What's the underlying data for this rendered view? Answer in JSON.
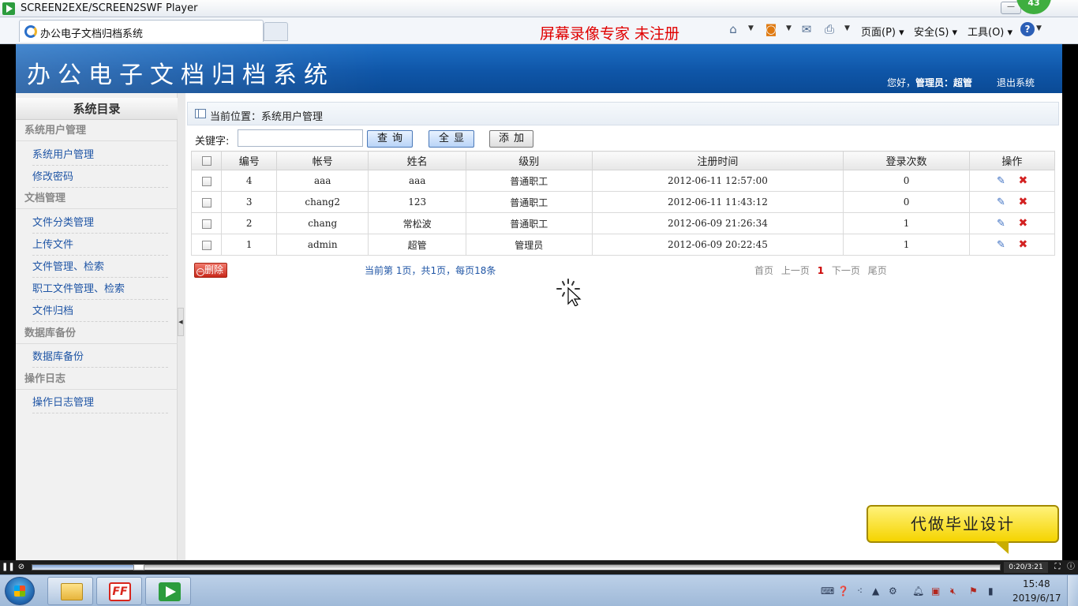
{
  "player": {
    "title": "SCREEN2EXE/SCREEN2SWF Player",
    "min_label": "—",
    "badge": "43",
    "time": "0:20/3:21",
    "progress": 0.11
  },
  "browser": {
    "tab_title": "办公电子文档归档系统",
    "watermark": "屏幕录像专家  未注册",
    "menus": [
      {
        "label": "页面(P)"
      },
      {
        "label": "安全(S)"
      },
      {
        "label": "工具(O)"
      }
    ],
    "help": "?"
  },
  "header": {
    "title": "办公电子文档归档系统",
    "greeting_prefix": "您好，",
    "role": "管理员：",
    "user": "超管",
    "logout": "退出系统"
  },
  "sidebar": {
    "title": "系统目录",
    "groups": [
      {
        "label": "系统用户管理"
      },
      {
        "label": "文档管理"
      },
      {
        "label": "数据库备份"
      },
      {
        "label": "操作日志"
      }
    ],
    "items": [
      {
        "label": "系统用户管理"
      },
      {
        "label": "修改密码"
      },
      {
        "label": "文件分类管理"
      },
      {
        "label": "上传文件"
      },
      {
        "label": "文件管理、检索"
      },
      {
        "label": "职工文件管理、检索"
      },
      {
        "label": "文件归档"
      },
      {
        "label": "数据库备份"
      },
      {
        "label": "操作日志管理"
      }
    ]
  },
  "main": {
    "breadcrumb": "当前位置：系统用户管理",
    "search": {
      "label": "关键字:",
      "value": "",
      "placeholder": ""
    },
    "buttons": {
      "query": "查询",
      "show_all": "全显",
      "add": "添加",
      "delete": "删除"
    },
    "table": {
      "headers": [
        "编号",
        "帐号",
        "姓名",
        "级别",
        "注册时间",
        "登录次数",
        "操作"
      ],
      "rows": [
        {
          "id": "4",
          "account": "aaa",
          "name": "aaa",
          "level": "普通职工",
          "registered": "2012-06-11 12:57:00",
          "logins": "0"
        },
        {
          "id": "3",
          "account": "chang2",
          "name": "123",
          "level": "普通职工",
          "registered": "2012-06-11 11:43:12",
          "logins": "0"
        },
        {
          "id": "2",
          "account": "chang",
          "name": "常松波",
          "level": "普通职工",
          "registered": "2012-06-09 21:26:34",
          "logins": "1"
        },
        {
          "id": "1",
          "account": "admin",
          "name": "超管",
          "level": "管理员",
          "registered": "2012-06-09 20:22:45",
          "logins": "1"
        }
      ]
    },
    "page_info": "当前第 1页，共1页，每页18条",
    "pager": {
      "first": "首页",
      "prev": "上一页",
      "current": "1",
      "next": "下一页",
      "last": "尾页"
    }
  },
  "ad": "代做毕业设计",
  "taskbar": {
    "time": "15:48",
    "date": "2019/6/17",
    "ff_label": "FF"
  },
  "colors": {
    "banner": "#0f56a8",
    "link": "#1f55a5",
    "watermark": "#e00000",
    "delete": "#c8281b"
  }
}
